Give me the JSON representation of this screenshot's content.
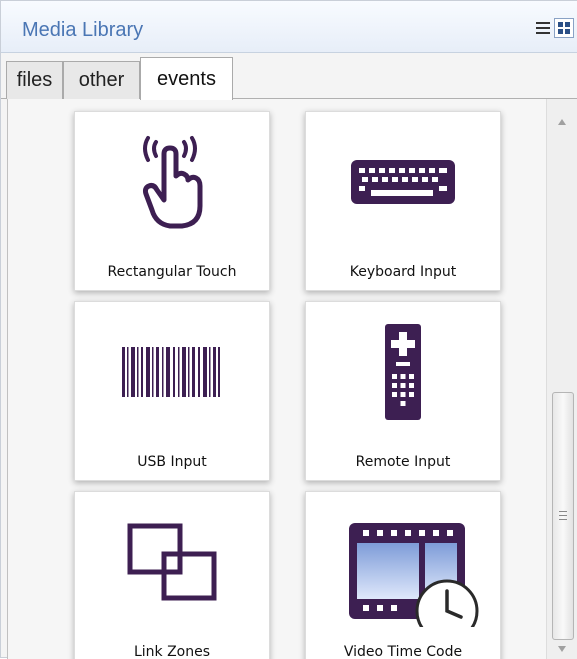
{
  "panel": {
    "title": "Media Library"
  },
  "view_buttons": [
    {
      "name": "list-view-button",
      "icon": "list-icon"
    },
    {
      "name": "grid-view-button",
      "icon": "grid-icon",
      "active": true
    }
  ],
  "tabs": [
    {
      "label": "files"
    },
    {
      "label": "other"
    },
    {
      "label": "events",
      "active": true
    }
  ],
  "tiles": [
    {
      "label": "Rectangular Touch",
      "icon": "touch-hand-icon"
    },
    {
      "label": "Keyboard Input",
      "icon": "keyboard-icon"
    },
    {
      "label": "USB Input",
      "icon": "barcode-icon"
    },
    {
      "label": "Remote Input",
      "icon": "remote-control-icon"
    },
    {
      "label": "Link Zones",
      "icon": "link-zones-icon"
    },
    {
      "label": "Video Time Code",
      "icon": "video-clock-icon"
    }
  ],
  "colors": {
    "icon": "#3d1f52",
    "title": "#4a76b4",
    "tab_border": "#aaaaaa"
  }
}
